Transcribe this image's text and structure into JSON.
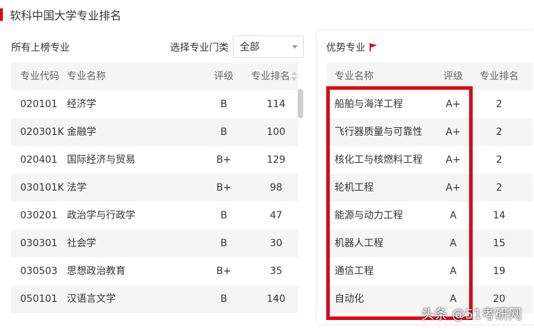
{
  "page_title": "软科中国大学专业排名",
  "colors": {
    "accent": "#e60012",
    "header_bg": "#f5f5f5"
  },
  "left": {
    "heading": "所有上榜专业",
    "filter_label": "选择专业门类",
    "filter_value": "全部",
    "headers": {
      "code": "专业代码",
      "name": "专业名称",
      "grade": "评级",
      "rank": "专业排名"
    },
    "rows": [
      {
        "code": "020101",
        "name": "经济学",
        "grade": "B",
        "rank": "114"
      },
      {
        "code": "020301K",
        "name": "金融学",
        "grade": "B",
        "rank": "100"
      },
      {
        "code": "020401",
        "name": "国际经济与贸易",
        "grade": "B+",
        "rank": "129"
      },
      {
        "code": "030101K",
        "name": "法学",
        "grade": "B+",
        "rank": "98"
      },
      {
        "code": "030201",
        "name": "政治学与行政学",
        "grade": "B",
        "rank": "47"
      },
      {
        "code": "030301",
        "name": "社会学",
        "grade": "B",
        "rank": "30"
      },
      {
        "code": "030503",
        "name": "思想政治教育",
        "grade": "B+",
        "rank": "35"
      },
      {
        "code": "050101",
        "name": "汉语言文学",
        "grade": "B",
        "rank": "140"
      }
    ]
  },
  "right": {
    "heading": "优势专业",
    "heading_icon": "flag-icon",
    "headers": {
      "name": "专业名称",
      "grade": "评级",
      "rank": "专业排名"
    },
    "rows": [
      {
        "name": "船舶与海洋工程",
        "grade": "A+",
        "rank": "2"
      },
      {
        "name": "飞行器质量与可靠性",
        "grade": "A+",
        "rank": "2"
      },
      {
        "name": "核化工与核燃料工程",
        "grade": "A+",
        "rank": "2"
      },
      {
        "name": "轮机工程",
        "grade": "A+",
        "rank": "2"
      },
      {
        "name": "能源与动力工程",
        "grade": "A",
        "rank": "14"
      },
      {
        "name": "机器人工程",
        "grade": "A",
        "rank": "15"
      },
      {
        "name": "通信工程",
        "grade": "A",
        "rank": "19"
      },
      {
        "name": "自动化",
        "grade": "A",
        "rank": "20"
      }
    ]
  },
  "watermark": "头条 @51考研网"
}
